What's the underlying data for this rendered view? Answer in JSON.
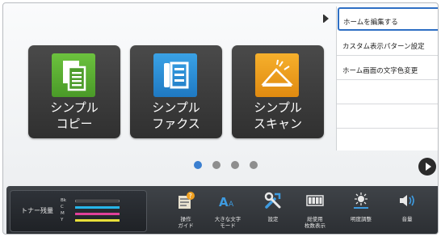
{
  "tiles": [
    {
      "label": "シンプル\nコピー",
      "icon": "copy-icon",
      "color": "#5bb032"
    },
    {
      "label": "シンプル\nファクス",
      "icon": "fax-icon",
      "color": "#2b8fd6"
    },
    {
      "label": "シンプル\nスキャン",
      "icon": "scan-icon",
      "color": "#f0a020"
    }
  ],
  "page_dots": {
    "count": 4,
    "active": 1
  },
  "menu": {
    "items": [
      {
        "label": "ホームを編集する",
        "selected": true
      },
      {
        "label": "カスタム表示パターン設定"
      },
      {
        "label": "ホーム画面の文字色変更"
      },
      {
        "label": ""
      },
      {
        "label": ""
      },
      {
        "label": ""
      }
    ]
  },
  "toner": {
    "label": "トナー残量",
    "colors": [
      {
        "name": "Bk",
        "color": "#111111"
      },
      {
        "name": "C",
        "color": "#27b5e8"
      },
      {
        "name": "M",
        "color": "#e0409a"
      },
      {
        "name": "Y",
        "color": "#e8df3a"
      }
    ]
  },
  "tools": [
    {
      "label": "操作\nガイド",
      "icon": "guide-icon"
    },
    {
      "label": "大きな文字\nモード",
      "icon": "large-text-icon"
    },
    {
      "label": "設定",
      "icon": "settings-icon"
    },
    {
      "label": "総使用\n枚数表示",
      "icon": "counter-icon"
    },
    {
      "label": "明度調整",
      "icon": "brightness-icon"
    },
    {
      "label": "音量",
      "icon": "volume-icon"
    }
  ]
}
